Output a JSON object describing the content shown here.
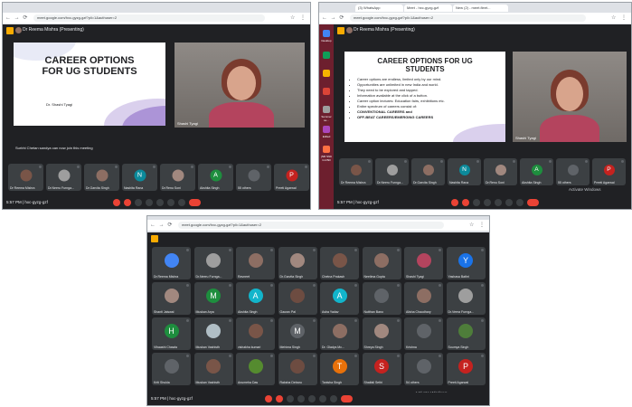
{
  "colors": {
    "meet_bg": "#202124",
    "tile_bg": "#3c4043",
    "red": "#ea4335",
    "badge": "#f9ab00",
    "blue": "#4285f4"
  },
  "shot1": {
    "url": "meet.google.com/hxc-gyzg-gzf?pli=1&authuser=2",
    "presenter": "Dr Reema Mishra (Presenting)",
    "slide_title": "CAREER OPTIONS FOR UG STUDENTS",
    "slide_author": "Dr. Shashi Tyagi",
    "camera_name": "Shashi Tyagi",
    "tiles": [
      {
        "label": "Dr Reema Mishra",
        "initial": "",
        "color": "#795548"
      },
      {
        "label": "Dr.Neeru Furnga...",
        "initial": "",
        "color": "#9e9e9e"
      },
      {
        "label": "Dr.Garvita Singh",
        "initial": "",
        "color": "#8d6e63"
      },
      {
        "label": "Nashita Rana",
        "initial": "N",
        "color": "#0b8a9b"
      },
      {
        "label": "Dr.Renu Soni",
        "initial": "",
        "color": "#a1887f"
      },
      {
        "label": "Akshita Singh",
        "initial": "A",
        "color": "#1e8e3e"
      },
      {
        "label": "55 others",
        "initial": "",
        "color": "#5f6368"
      },
      {
        "label": "Preeti Agarwal",
        "initial": "P",
        "color": "#c5221f"
      }
    ],
    "caption": "Surbhi Chetan sandya can now join this meeting",
    "clock": "5:57 PM | hxc-gyzg-gzf"
  },
  "shot2": {
    "tabs": [
      "(3) WhatsApp",
      "Meet - hxc-gyzg-gzf",
      "New (2) - meet.fleet..."
    ],
    "url": "meet.google.com/hxc-gyzg-gzf?pli=1&authuser=2",
    "presenter": "Dr Reema Mishra (Presenting)",
    "slide_title": "CAREER OPTIONS FOR UG STUDENTS",
    "bullets": [
      "Career options are endless, limited only by our mind.",
      "Opportunities are unlimited in new India and world.",
      "They need to be explored and tapped.",
      "Information available at the click of a button.",
      "Career option lectures: Education fairs, exhibitions etc.",
      "Entire spectrum of careers consist of:",
      "CONVENTIONAL CAREERS and",
      "OFF-BEAT CAREERS/EMERGING CAREERS"
    ],
    "camera_name": "Shashi Tyagi",
    "sidebar_labels": [
      "Desktop",
      "Summer se...",
      "Edited",
      "jNR Shilt Ind Bill"
    ],
    "tiles": [
      {
        "label": "Dr Reema Mishra",
        "initial": "",
        "color": "#795548"
      },
      {
        "label": "Dr.Neeru Furnga...",
        "initial": "",
        "color": "#9e9e9e"
      },
      {
        "label": "Dr.Garvita Singh",
        "initial": "",
        "color": "#8d6e63"
      },
      {
        "label": "Nashita Rana",
        "initial": "N",
        "color": "#0b8a9b"
      },
      {
        "label": "Dr.Renu Soni",
        "initial": "",
        "color": "#a1887f"
      },
      {
        "label": "Akshita Singh",
        "initial": "A",
        "color": "#1e8e3e"
      },
      {
        "label": "55 others",
        "initial": "",
        "color": "#5f6368"
      },
      {
        "label": "Preeti Agarwal",
        "initial": "P",
        "color": "#c5221f"
      }
    ],
    "watermark": "Activate Windows",
    "clock": "5:57 PM | hxc-gyzg-gzf"
  },
  "shot3": {
    "url": "meet.google.com/hxc-gyzg-gzf?pli=1&authuser=2",
    "tiles": [
      {
        "label": "Dr.Reema Mishra",
        "initial": "",
        "color": "#4285f4"
      },
      {
        "label": "Dr.Neeru Furnga...",
        "initial": "",
        "color": "#9e9e9e"
      },
      {
        "label": "Ravneet",
        "initial": "",
        "color": "#8d6e63"
      },
      {
        "label": "Dr.Garvita Singh",
        "initial": "",
        "color": "#a1887f"
      },
      {
        "label": "Chetna Prakash",
        "initial": "",
        "color": "#795548"
      },
      {
        "label": "Neelima Gupta",
        "initial": "",
        "color": "#8d6e63"
      },
      {
        "label": "Shashi Tyagi",
        "initial": "",
        "color": "#b4445e"
      },
      {
        "label": "Yashasa Bathri",
        "initial": "Y",
        "color": "#1a73e8"
      },
      {
        "label": "Shanti Jaiswal",
        "initial": "",
        "color": "#a1887f"
      },
      {
        "label": "Muskan Arya",
        "initial": "M",
        "color": "#1e8e3e"
      },
      {
        "label": "Akshita Singh",
        "initial": "A",
        "color": "#12b5cb"
      },
      {
        "label": "Gaurav Pal",
        "initial": "",
        "color": "#6d4c41"
      },
      {
        "label": "Asha Yadav",
        "initial": "A",
        "color": "#12b5cb"
      },
      {
        "label": "Nutthan Bano",
        "initial": "",
        "color": "#5f6368"
      },
      {
        "label": "Alisha Chaudhary",
        "initial": "",
        "color": "#8d6e63"
      },
      {
        "label": "Dr.Veera Furnga...",
        "initial": "",
        "color": "#9e9e9e"
      },
      {
        "label": "Vihaashi Chawla",
        "initial": "H",
        "color": "#1e8e3e"
      },
      {
        "label": "Muskan Vashisth",
        "initial": "",
        "color": "#b0bec5"
      },
      {
        "label": "vishakha kumari",
        "initial": "",
        "color": "#795548"
      },
      {
        "label": "Mehima Singh",
        "initial": "M",
        "color": "#5f6368"
      },
      {
        "label": "Dr. Gladys Mc...",
        "initial": "",
        "color": "#8d6e63"
      },
      {
        "label": "Shreya Singh",
        "initial": "",
        "color": "#a1887f"
      },
      {
        "label": "Krishna",
        "initial": "",
        "color": "#5f6368"
      },
      {
        "label": "Soumya Singh",
        "initial": "",
        "color": "#4e7d3a"
      },
      {
        "label": "Kriti Shukla",
        "initial": "",
        "color": "#5f6368"
      },
      {
        "label": "Muskan Vashisth",
        "initial": "",
        "color": "#795548"
      },
      {
        "label": "Anumeha Das",
        "initial": "",
        "color": "#558b2f"
      },
      {
        "label": "Raksha Debaru",
        "initial": "",
        "color": "#6d4c41"
      },
      {
        "label": "Tanisha Singh",
        "initial": "T",
        "color": "#e8710a"
      },
      {
        "label": "Shaifali Sethi",
        "initial": "S",
        "color": "#c5221f"
      },
      {
        "label": "54 others",
        "initial": "",
        "color": "#5f6368"
      },
      {
        "label": "Preeti Agarwal",
        "initial": "P",
        "color": "#c5221f"
      }
    ],
    "watermark": "Activate Windows",
    "clock": "5:57 PM | hxc-gyzg-gzf"
  }
}
